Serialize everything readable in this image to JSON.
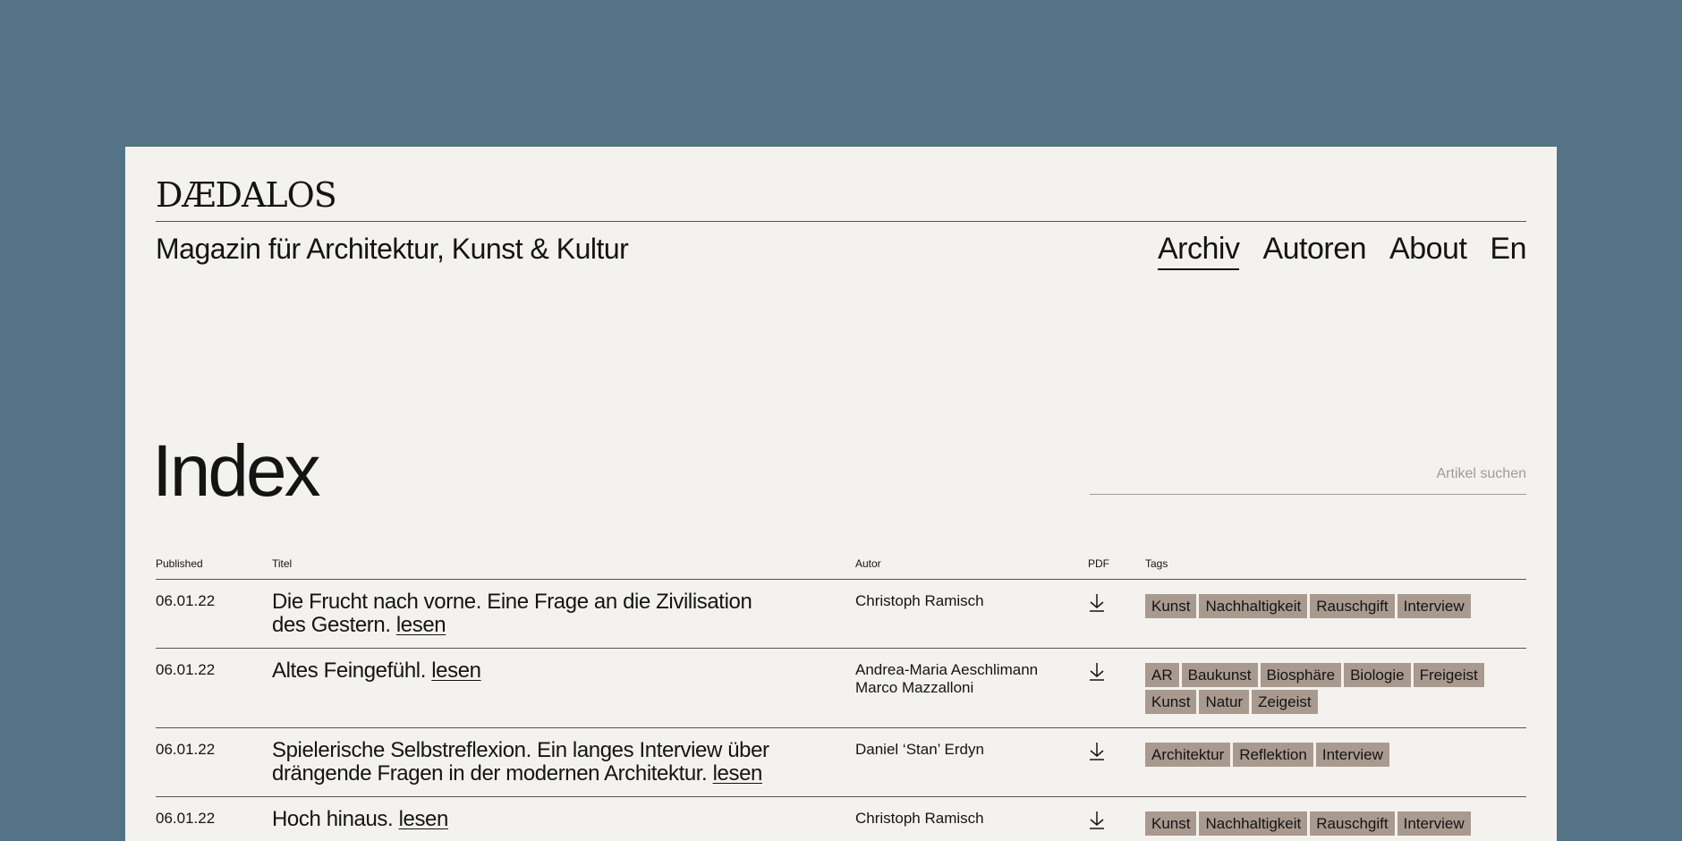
{
  "site": {
    "logo": "DÆDALOS",
    "tagline": "Magazin für Architektur, Kunst & Kultur"
  },
  "nav": {
    "items": [
      {
        "label": "Archiv",
        "active": true
      },
      {
        "label": "Autoren",
        "active": false
      },
      {
        "label": "About",
        "active": false
      },
      {
        "label": "En",
        "active": false
      }
    ]
  },
  "index": {
    "title": "Index",
    "search_placeholder": "Artikel suchen"
  },
  "table": {
    "headers": {
      "published": "Published",
      "title": "Titel",
      "author": "Autor",
      "pdf": "PDF",
      "tags": "Tags"
    },
    "read_label": "lesen",
    "rows": [
      {
        "date": "06.01.22",
        "title": "Die Frucht nach vorne. Eine Frage an die Zivilisation des Gestern.",
        "authors": [
          "Christoph Ramisch"
        ],
        "tags": [
          "Kunst",
          "Nachhaltigkeit",
          "Rauschgift",
          "Interview"
        ]
      },
      {
        "date": "06.01.22",
        "title": "Altes Feingefühl.",
        "authors": [
          "Andrea-Maria Aeschlimann",
          "Marco Mazzalloni"
        ],
        "tags": [
          "AR",
          "Baukunst",
          "Biosphäre",
          "Biologie",
          "Freigeist",
          "Kunst",
          "Natur",
          "Zeigeist"
        ]
      },
      {
        "date": "06.01.22",
        "title": "Spielerische Selbstreflexion. Ein langes Interview über drängende Fragen in der modernen Architektur.",
        "authors": [
          "Daniel ‘Stan’ Erdyn"
        ],
        "tags": [
          "Architektur",
          "Reflektion",
          "Interview"
        ]
      },
      {
        "date": "06.01.22",
        "title": "Hoch hinaus.",
        "authors": [
          "Christoph Ramisch"
        ],
        "tags": [
          "Kunst",
          "Nachhaltigkeit",
          "Rauschgift",
          "Interview"
        ]
      }
    ]
  },
  "icons": {
    "pdf": "download-arrow-icon"
  },
  "colors": {
    "backdrop": "#557386",
    "paper": "#f4f2ee",
    "tag_bg": "#a99a8f",
    "text": "#141414"
  }
}
